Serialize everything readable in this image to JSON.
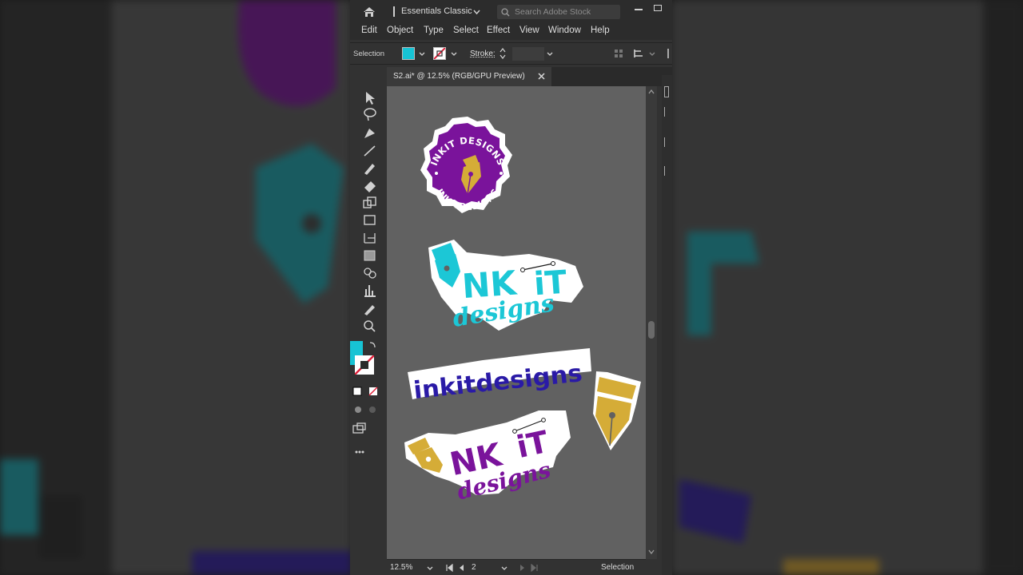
{
  "titlebar": {
    "workspace": "Essentials Classic",
    "search_placeholder": "Search Adobe Stock"
  },
  "menubar": {
    "items": [
      "Edit",
      "Object",
      "Type",
      "Select",
      "Effect",
      "View",
      "Window",
      "Help"
    ]
  },
  "controlbar": {
    "selection_label": "Selection",
    "stroke_label": "Stroke:",
    "fill_color": "#17c3d4"
  },
  "document": {
    "tab_title": "S2.ai* @ 12.5% (RGB/GPU Preview)"
  },
  "artwork": {
    "badge_top_text": "INKIT DESIGNS",
    "badge_bottom_text": "INKITDESIGNS",
    "logo_cyan_word": "NK",
    "logo_cyan_it": "iT",
    "logo_cyan_script": "designs",
    "banner_text": "inkitdesigns",
    "logo_purple_word": "NK",
    "logo_purple_it": "iT",
    "logo_purple_script": "designs",
    "colors": {
      "purple": "#7a139b",
      "cyan": "#1cc7d6",
      "navy": "#2a1aa6",
      "gold": "#d5ac37",
      "white": "#ffffff"
    }
  },
  "statusbar": {
    "zoom": "12.5%",
    "artboard": "2",
    "tool": "Selection"
  }
}
